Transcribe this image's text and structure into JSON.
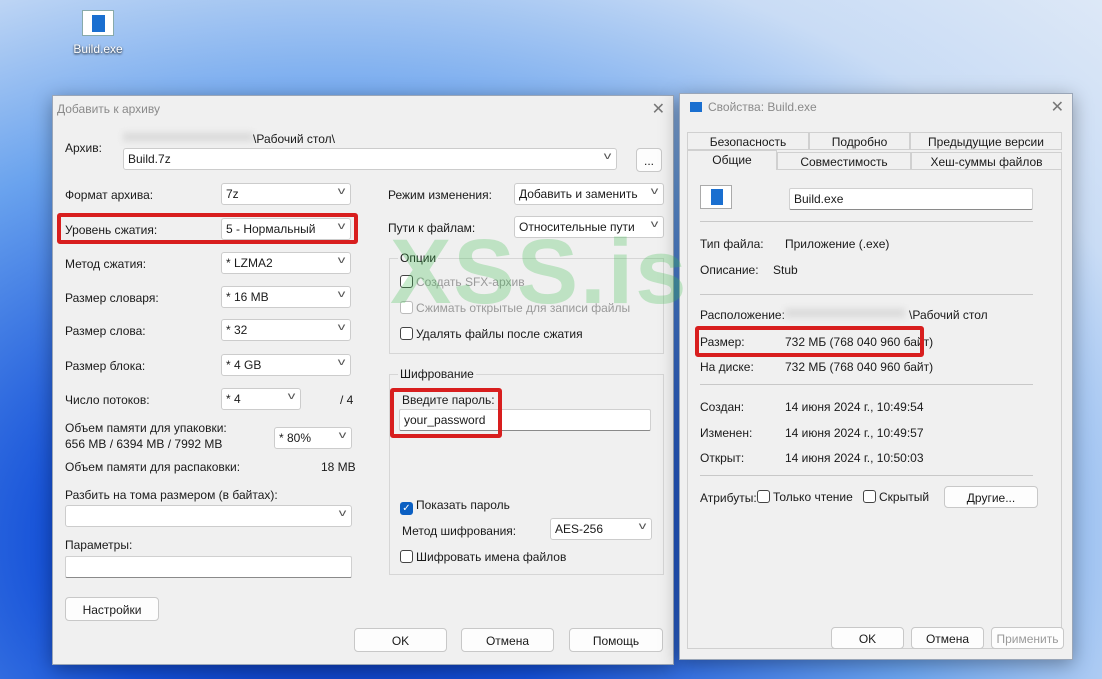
{
  "desktop": {
    "icon_label": "Build.exe"
  },
  "watermark": "XSS.is",
  "archive_dialog": {
    "title": "Добавить к архиву",
    "archive_label": "Архив:",
    "archive_path_suffix": "\\Рабочий стол\\",
    "archive_name": "Build.7z",
    "browse_label": "...",
    "format_label": "Формат архива:",
    "format_value": "7z",
    "level_label": "Уровень сжатия:",
    "level_value": "5 - Нормальный",
    "method_label": "Метод сжатия:",
    "method_value": "*  LZMA2",
    "dict_label": "Размер словаря:",
    "dict_value": "*  16 MB",
    "word_label": "Размер слова:",
    "word_value": "*  32",
    "block_label": "Размер блока:",
    "block_value": "*  4 GB",
    "threads_label": "Число потоков:",
    "threads_value": "*  4",
    "threads_max": "/ 4",
    "mem_pack_label": "Объем памяти для упаковки:",
    "mem_pack_value": "656 MB / 6394 MB / 7992 MB",
    "mem_pack_percent": "*  80%",
    "mem_unpack_label": "Объем памяти для распаковки:",
    "mem_unpack_value": "18 MB",
    "split_label": "Разбить на тома размером (в байтах):",
    "split_value": "",
    "params_label": "Параметры:",
    "params_value": "",
    "settings_button": "Настройки",
    "update_mode_label": "Режим изменения:",
    "update_mode_value": "Добавить и заменить",
    "paths_label": "Пути к файлам:",
    "paths_value": "Относительные пути",
    "options_label": "Опции",
    "opt_sfx": "Создать SFX-архив",
    "opt_shared": "Сжимать открытые для записи файлы",
    "opt_delete": "Удалять файлы после сжатия",
    "encryption_label": "Шифрование",
    "password_label": "Введите пароль:",
    "password_value": "your_password",
    "show_password": "Показать пароль",
    "enc_method_label": "Метод шифрования:",
    "enc_method_value": "AES-256",
    "encrypt_names": "Шифровать имена файлов",
    "ok": "OK",
    "cancel": "Отмена",
    "help": "Помощь"
  },
  "props_dialog": {
    "title": "Свойства: Build.exe",
    "tabs_row1": [
      "Безопасность",
      "Подробно",
      "Предыдущие версии"
    ],
    "tabs_row2": [
      "Общие",
      "Совместимость",
      "Хеш-суммы файлов"
    ],
    "file_name": "Build.exe",
    "type_label": "Тип файла:",
    "type_value": "Приложение (.exe)",
    "desc_label": "Описание:",
    "desc_value": "Stub",
    "location_label": "Расположение:",
    "location_suffix": "\\Рабочий стол",
    "size_label": "Размер:",
    "size_value": "732 МБ (768 040 960 байт)",
    "disk_label": "На диске:",
    "disk_value": "732 МБ (768 040 960 байт)",
    "created_label": "Создан:",
    "created_value": "14 июня 2024 г., 10:49:54",
    "modified_label": "Изменен:",
    "modified_value": "14 июня 2024 г., 10:49:57",
    "opened_label": "Открыт:",
    "opened_value": "14 июня 2024 г., 10:50:03",
    "attributes_label": "Атрибуты:",
    "readonly": "Только чтение",
    "hidden": "Скрытый",
    "other_button": "Другие...",
    "ok": "OK",
    "cancel": "Отмена",
    "apply": "Применить"
  },
  "colors": {
    "highlight": "#d81e1e",
    "checkbox_accent": "#0a5fc2",
    "watermark": "#3cbe50"
  }
}
